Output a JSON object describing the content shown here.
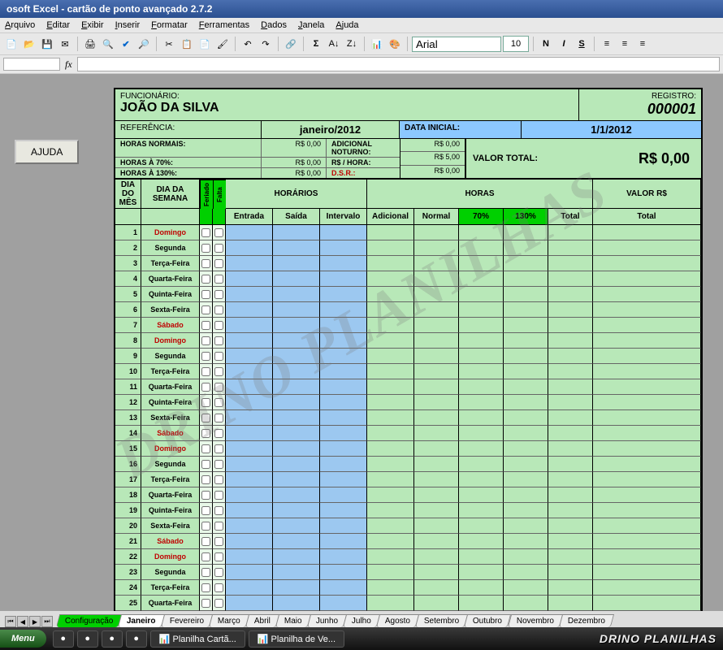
{
  "window": {
    "title": "osoft Excel - cartão de ponto avançado 2.7.2"
  },
  "menu": [
    "Arquivo",
    "Editar",
    "Exibir",
    "Inserir",
    "Formatar",
    "Ferramentas",
    "Dados",
    "Janela",
    "Ajuda"
  ],
  "font": {
    "name": "Arial",
    "size": "10"
  },
  "cellref": "",
  "ajuda": "AJUDA",
  "header": {
    "func_label": "FUNCIONÁRIO:",
    "func_name": "JOÃO DA SILVA",
    "reg_label": "REGISTRO:",
    "reg_val": "000001",
    "ref_label": "REFERÊNCIA:",
    "ref_val": "janeiro/2012",
    "di_label": "DATA INICIAL:",
    "di_val": "1/1/2012"
  },
  "totals": {
    "rows": [
      {
        "l": "HORAS NORMAIS:",
        "v": "R$ 0,00",
        "l2": "ADICIONAL NOTURNO:",
        "v2": "R$ 0,00"
      },
      {
        "l": "HORAS À 70%:",
        "v": "R$ 0,00",
        "l2": "R$ / HORA:",
        "v2": "R$ 5,00"
      },
      {
        "l": "HORAS À 130%:",
        "v": "R$ 0,00",
        "l2": "D.S.R.:",
        "v2": "R$ 0,00"
      }
    ],
    "total_label": "VALOR TOTAL:",
    "total_val": "R$ 0,00"
  },
  "cols": {
    "dia": "DIA DO MÊS",
    "semana": "DIA DA SEMANA",
    "feriado": "Feriado",
    "falta": "Falta",
    "horarios": "HORÁRIOS",
    "horas": "HORAS",
    "valor": "VALOR R$",
    "entrada": "Entrada",
    "saida": "Saída",
    "intervalo": "Intervalo",
    "adicional": "Adicional",
    "normal": "Normal",
    "p70": "70%",
    "p130": "130%",
    "total": "Total",
    "vtotal": "Total"
  },
  "days": [
    {
      "n": "1",
      "d": "Domingo",
      "red": true
    },
    {
      "n": "2",
      "d": "Segunda",
      "red": false
    },
    {
      "n": "3",
      "d": "Terça-Feira",
      "red": false
    },
    {
      "n": "4",
      "d": "Quarta-Feira",
      "red": false
    },
    {
      "n": "5",
      "d": "Quinta-Feira",
      "red": false
    },
    {
      "n": "6",
      "d": "Sexta-Feira",
      "red": false
    },
    {
      "n": "7",
      "d": "Sábado",
      "red": true
    },
    {
      "n": "8",
      "d": "Domingo",
      "red": true
    },
    {
      "n": "9",
      "d": "Segunda",
      "red": false
    },
    {
      "n": "10",
      "d": "Terça-Feira",
      "red": false
    },
    {
      "n": "11",
      "d": "Quarta-Feira",
      "red": false
    },
    {
      "n": "12",
      "d": "Quinta-Feira",
      "red": false
    },
    {
      "n": "13",
      "d": "Sexta-Feira",
      "red": false
    },
    {
      "n": "14",
      "d": "Sábado",
      "red": true
    },
    {
      "n": "15",
      "d": "Domingo",
      "red": true
    },
    {
      "n": "16",
      "d": "Segunda",
      "red": false
    },
    {
      "n": "17",
      "d": "Terça-Feira",
      "red": false
    },
    {
      "n": "18",
      "d": "Quarta-Feira",
      "red": false
    },
    {
      "n": "19",
      "d": "Quinta-Feira",
      "red": false
    },
    {
      "n": "20",
      "d": "Sexta-Feira",
      "red": false
    },
    {
      "n": "21",
      "d": "Sábado",
      "red": true
    },
    {
      "n": "22",
      "d": "Domingo",
      "red": true
    },
    {
      "n": "23",
      "d": "Segunda",
      "red": false
    },
    {
      "n": "24",
      "d": "Terça-Feira",
      "red": false
    },
    {
      "n": "25",
      "d": "Quarta-Feira",
      "red": false
    }
  ],
  "tabs": [
    "Configuração",
    "Janeiro",
    "Fevereiro",
    "Março",
    "Abril",
    "Maio",
    "Junho",
    "Julho",
    "Agosto",
    "Setembro",
    "Outubro",
    "Novembro",
    "Dezembro"
  ],
  "active_tab": 1,
  "taskbar": {
    "start": "Menu",
    "items": [
      "",
      "",
      "",
      "",
      "Planilha Cartã...",
      "Planilha de Ve..."
    ],
    "brand": "DRINO PLANILHAS"
  },
  "watermark": "DRINO PLANILHAS"
}
